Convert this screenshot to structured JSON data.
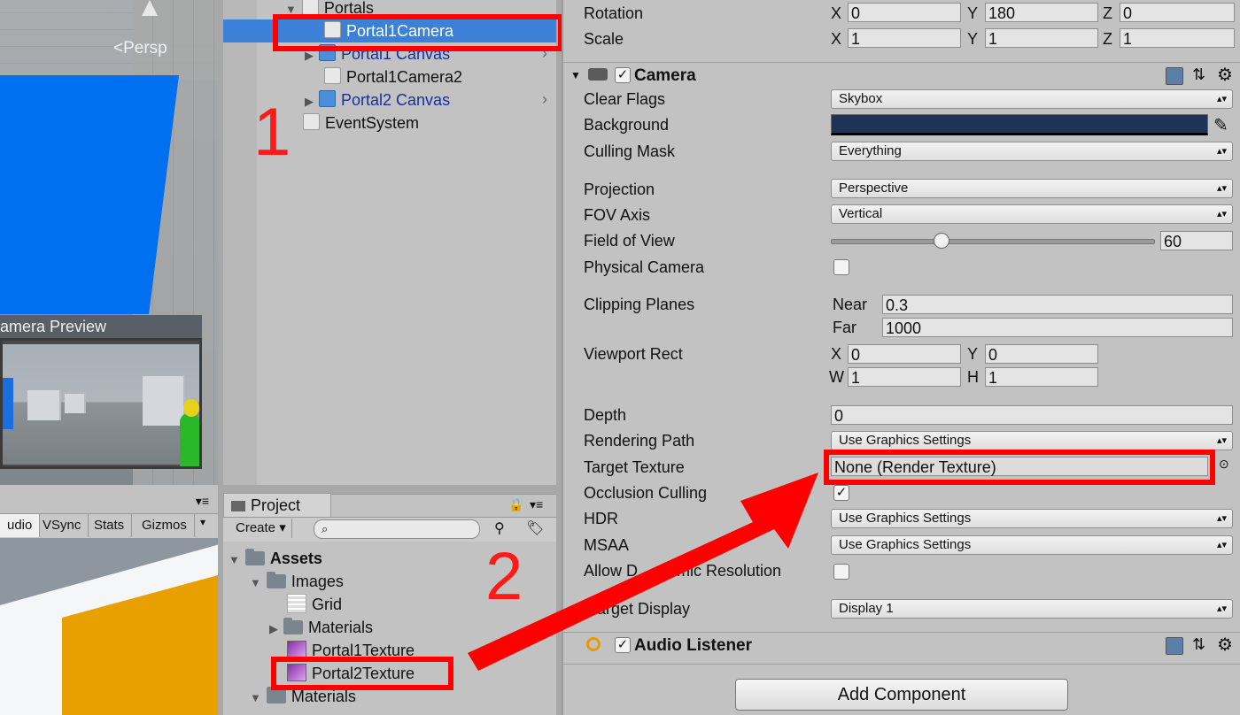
{
  "scene": {
    "persp_label": "Persp",
    "camera_preview_title": "amera Preview"
  },
  "game_toolbar": [
    "udio",
    "VSync",
    "Stats",
    "Gizmos"
  ],
  "hierarchy": {
    "rows": [
      {
        "label": "Portals"
      },
      {
        "label": "Portal1Camera"
      },
      {
        "label": "Portal1 Canvas"
      },
      {
        "label": "Portal1Camera2"
      },
      {
        "label": "Portal2 Canvas"
      },
      {
        "label": "EventSystem"
      }
    ]
  },
  "project": {
    "tab_label": "Project",
    "create_label": "Create",
    "items": [
      {
        "label": "Assets"
      },
      {
        "label": "Images"
      },
      {
        "label": "Grid"
      },
      {
        "label": "Materials"
      },
      {
        "label": "Portal1Texture"
      },
      {
        "label": "Portal2Texture"
      },
      {
        "label": "Materials"
      }
    ]
  },
  "transform": {
    "rotation_label": "Rotation",
    "scale_label": "Scale",
    "rotation": {
      "x": "0",
      "y": "180",
      "z": "0"
    },
    "scale": {
      "x": "1",
      "y": "1",
      "z": "1"
    },
    "axis": {
      "x": "X",
      "y": "Y",
      "z": "Z"
    }
  },
  "camera": {
    "title": "Camera",
    "clear_flags": {
      "label": "Clear Flags",
      "value": "Skybox"
    },
    "background": {
      "label": "Background",
      "color": "#1e3358"
    },
    "culling_mask": {
      "label": "Culling Mask",
      "value": "Everything"
    },
    "projection": {
      "label": "Projection",
      "value": "Perspective"
    },
    "fov_axis": {
      "label": "FOV Axis",
      "value": "Vertical"
    },
    "field_of_view": {
      "label": "Field of View",
      "value": "60",
      "slider_fraction": 0.34
    },
    "physical_camera": {
      "label": "Physical Camera"
    },
    "clipping": {
      "label": "Clipping Planes",
      "near_label": "Near",
      "near": "0.3",
      "far_label": "Far",
      "far": "1000"
    },
    "viewport": {
      "label": "Viewport Rect",
      "x": "0",
      "y": "0",
      "w": "1",
      "h": "1",
      "x_l": "X",
      "y_l": "Y",
      "w_l": "W",
      "h_l": "H"
    },
    "depth": {
      "label": "Depth",
      "value": "0"
    },
    "rendering_path": {
      "label": "Rendering Path",
      "value": "Use Graphics Settings"
    },
    "target_texture": {
      "label": "Target Texture",
      "value": "None (Render Texture)"
    },
    "occlusion": {
      "label": "Occlusion Culling"
    },
    "hdr": {
      "label": "HDR",
      "value": "Use Graphics Settings"
    },
    "msaa": {
      "label": "MSAA",
      "value": "Use Graphics Settings"
    },
    "dynamic_res": {
      "label": "Allow Dynamic Resolution",
      "label_visible_a": "Allow D",
      "label_visible_b": "mic Resolution"
    },
    "target_display": {
      "label": "arget Display",
      "value": "Display 1"
    }
  },
  "audio_listener": {
    "title": "Audio Listener"
  },
  "add_component": "Add Component",
  "annotations": {
    "one": "1",
    "two": "2"
  },
  "colors": {
    "selection": "#3c80d8",
    "annotation_red": "#ff0000",
    "blue_plane": "#0070f0",
    "yellow_box": "#e8a000"
  }
}
